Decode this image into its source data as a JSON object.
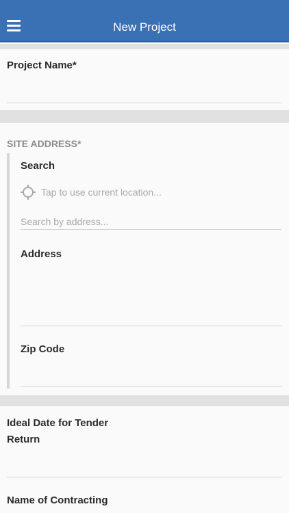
{
  "header": {
    "menu_icon": "hamburger-menu-icon",
    "title": "New Project",
    "color": "#3a71b5"
  },
  "project_name": {
    "label": "Project Name*",
    "value": ""
  },
  "site_address": {
    "section_label": "SITE ADDRESS*",
    "search": {
      "label": "Search",
      "location_icon": "crosshair-location-icon",
      "use_location_text": "Tap to use current location...",
      "placeholder": "Search by address..."
    },
    "address": {
      "label": "Address",
      "value": ""
    },
    "zip_code": {
      "label": "Zip Code",
      "value": ""
    }
  },
  "ideal_date": {
    "label_line1": "Ideal Date for Tender",
    "label_line2": "Return",
    "value": ""
  },
  "contracting": {
    "label": "Name of Contracting"
  }
}
